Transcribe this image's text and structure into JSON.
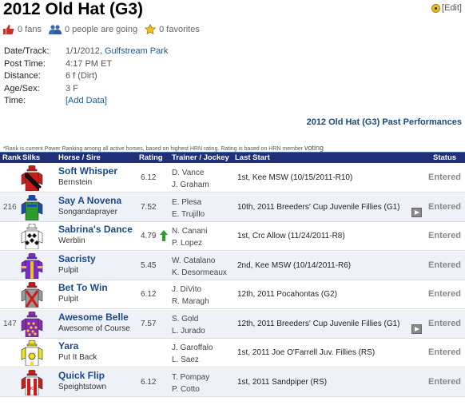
{
  "page": {
    "title": "2012 Old Hat (G3)",
    "edit_label": "[Edit]"
  },
  "social": {
    "fans": "0 fans",
    "going": "0 people are going",
    "favorites": "0 favorites"
  },
  "details": [
    {
      "label": "Date/Track:",
      "value": "1/1/2012,",
      "link": "Gulfstream Park"
    },
    {
      "label": "Post Time:",
      "value": "4:17 PM ET",
      "link": ""
    },
    {
      "label": "Distance:",
      "value": "6 f (Dirt)",
      "link": ""
    },
    {
      "label": "Age/Sex:",
      "value": "3 F",
      "link": ""
    },
    {
      "label": "Time:",
      "value": "",
      "link": "[Add Data]"
    }
  ],
  "past_performances_title": "2012 Old Hat (G3) Past Performances",
  "note": {
    "text": "*Rank is current Power Ranking among all active horses, based on highest HRN rating. Rating is based on HRN member",
    "voting": "voting"
  },
  "table": {
    "headers": {
      "rank": "Rank",
      "silks": "Silks",
      "horse": "Horse / Sire",
      "rating": "Rating",
      "trainer": "Trainer / Jockey",
      "last_start": "Last Start",
      "status": "Status"
    },
    "rows": [
      {
        "rank": "",
        "horse": "Soft Whisper",
        "sire": "Bernstein",
        "rating": "6.12",
        "trainer": "D. Vance",
        "jockey": "J. Graham",
        "last_start": "1st, Kee MSW (10/15/2011-R10)",
        "status": "Entered",
        "video": false,
        "arrow": false,
        "silk": "red-black-diag"
      },
      {
        "rank": "216",
        "horse": "Say A Novena",
        "sire": "Songandaprayer",
        "rating": "7.52",
        "trainer": "E. Plesa",
        "jockey": "E. Trujillo",
        "last_start": "10th, 2011 Breeders' Cup Juvenile Fillies (G1)",
        "status": "Entered",
        "video": true,
        "arrow": false,
        "silk": "green-blue"
      },
      {
        "rank": "",
        "horse": "Sabrina's Dance",
        "sire": "Werblin",
        "rating": "4.79",
        "trainer": "N. Canani",
        "jockey": "P. Lopez",
        "last_start": "1st, Crc Allow (11/24/2011-R8)",
        "status": "Entered",
        "video": false,
        "arrow": true,
        "silk": "white-black-diamonds"
      },
      {
        "rank": "",
        "horse": "Sacristy",
        "sire": "Pulpit",
        "rating": "5.45",
        "trainer": "W. Catalano",
        "jockey": "K. Desormeaux",
        "last_start": "2nd, Kee MSW (10/14/2011-R6)",
        "status": "Entered",
        "video": false,
        "arrow": false,
        "silk": "purple-yellow"
      },
      {
        "rank": "",
        "horse": "Bet To Win",
        "sire": "Pulpit",
        "rating": "6.12",
        "trainer": "J. DiVito",
        "jockey": "R. Maragh",
        "last_start": "12th, 2011 Pocahontas (G2)",
        "status": "Entered",
        "video": false,
        "arrow": false,
        "silk": "grey-red-x"
      },
      {
        "rank": "147",
        "horse": "Awesome Belle",
        "sire": "Awesome of Course",
        "rating": "7.57",
        "trainer": "S. Gold",
        "jockey": "L. Jurado",
        "last_start": "12th, 2011 Breeders' Cup Juvenile Fillies (G1)",
        "status": "Entered",
        "video": true,
        "arrow": false,
        "silk": "purple-yellow-dots"
      },
      {
        "rank": "",
        "horse": "Yara",
        "sire": "Put It Back",
        "rating": "",
        "trainer": "J. Garoffalo",
        "jockey": "L. Saez",
        "last_start": "1st, 2011 Joe O'Farrell Juv. Fillies (RS)",
        "status": "Entered",
        "video": false,
        "arrow": false,
        "silk": "yellow-white"
      },
      {
        "rank": "",
        "horse": "Quick Flip",
        "sire": "Speightstown",
        "rating": "6.12",
        "trainer": "T. Pompay",
        "jockey": "P. Cotto",
        "last_start": "1st, 2011 Sandpiper (RS)",
        "status": "Entered",
        "video": false,
        "arrow": false,
        "silk": "red-white-ks"
      }
    ]
  },
  "colors": {
    "header_bg": "#1f2f7a",
    "link": "#1a4a8a",
    "row_alt": "#eef2f8"
  }
}
